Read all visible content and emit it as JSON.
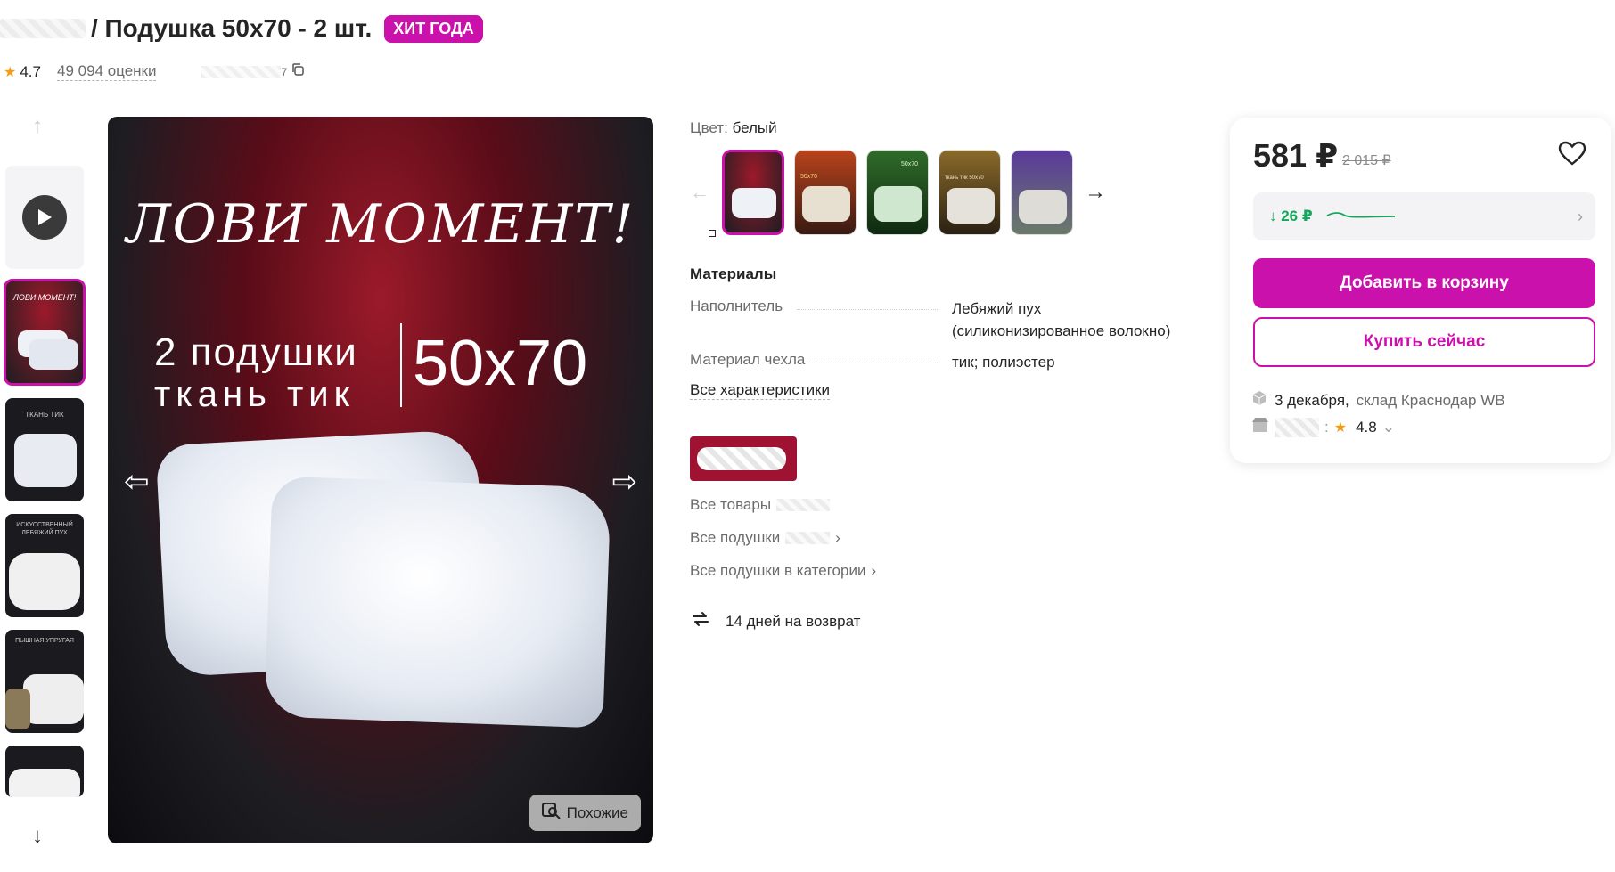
{
  "header": {
    "title": "/ Подушка 50x70 - 2 шт.",
    "badge": "ХИТ ГОДА",
    "rating": "4.7",
    "reviews": "49 094 оценки",
    "article_suffix": "7"
  },
  "gallery": {
    "thumb_labels": [
      "ЛОВИ МОМЕНТ!",
      "ТКАНЬ ТИК",
      "ИСКУССТВЕННЫЙ ЛЕБЯЖИЙ ПУХ",
      "ПЫШНАЯ УПРУГАЯ",
      ""
    ],
    "hero_title": "ЛОВИ МОМЕНТ!",
    "hero_line1": "2 подушки",
    "hero_line2": "ткань тик",
    "hero_size": "50x70",
    "similar_label": "Похожие"
  },
  "product": {
    "color_label": "Цвет:",
    "color_value": "белый",
    "swatch_sizes": [
      "",
      "50x70",
      "50x70",
      "ткань тик 50x70",
      ""
    ],
    "materials_title": "Материалы",
    "specs": [
      {
        "name": "Наполнитель",
        "value": "Лебяжий пух (силиконизированное волокно)"
      },
      {
        "name": "Материал чехла",
        "value": "тик; полиэстер"
      }
    ],
    "all_characteristics": "Все характеристики",
    "links": [
      "Все товары",
      "Все подушки",
      "Все подушки в категории"
    ],
    "return_text": "14 дней на возврат"
  },
  "buy": {
    "price": "581 ₽",
    "old_price": "2 015 ₽",
    "trend": "↓ 26 ₽",
    "add_to_cart": "Добавить в корзину",
    "buy_now": "Купить сейчас",
    "delivery_date": "3 декабря,",
    "delivery_warehouse": "склад Краснодар WB",
    "seller_rating": "4.8"
  },
  "colors": {
    "accent": "#cb11ab",
    "positive": "#12a85b"
  }
}
